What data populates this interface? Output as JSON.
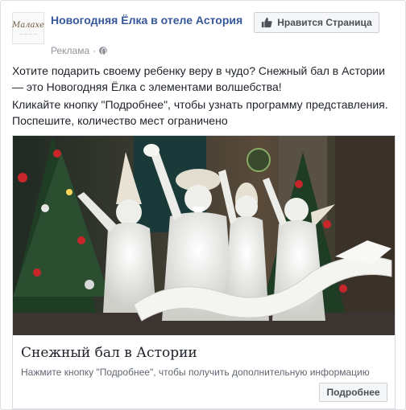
{
  "post": {
    "page_name": "Новогодняя Ёлка в отеле Астория",
    "sponsored_label": "Реклама",
    "separator": "·",
    "avatar": {
      "logo_text": "Малахе",
      "icon": "hotel-logo-icon"
    },
    "like_button": {
      "label": "Нравится Страница",
      "icon": "thumbs-up-icon"
    },
    "text_paragraphs": [
      "Хотите подарить своему ребенку веру в чудо? Снежный бал в Астории — это Новогодняя Ёлка с элементами волшебства!",
      "Кликайте кнопку \"Подробнее\", чтобы узнать программу представления. Поспешите, количество мест ограничено"
    ],
    "card": {
      "image_icon": "snow-ball-performers-photo",
      "title": "Снежный бал в Астории",
      "description": "Нажмите кнопку \"Подробнее\", чтобы получить дополнительную информацию",
      "cta_label": "Подробнее"
    }
  },
  "colors": {
    "link": "#365899",
    "text": "#1d2129",
    "muted": "#90949c",
    "button_bg": "#f5f6f7",
    "border": "#dddfe2"
  }
}
